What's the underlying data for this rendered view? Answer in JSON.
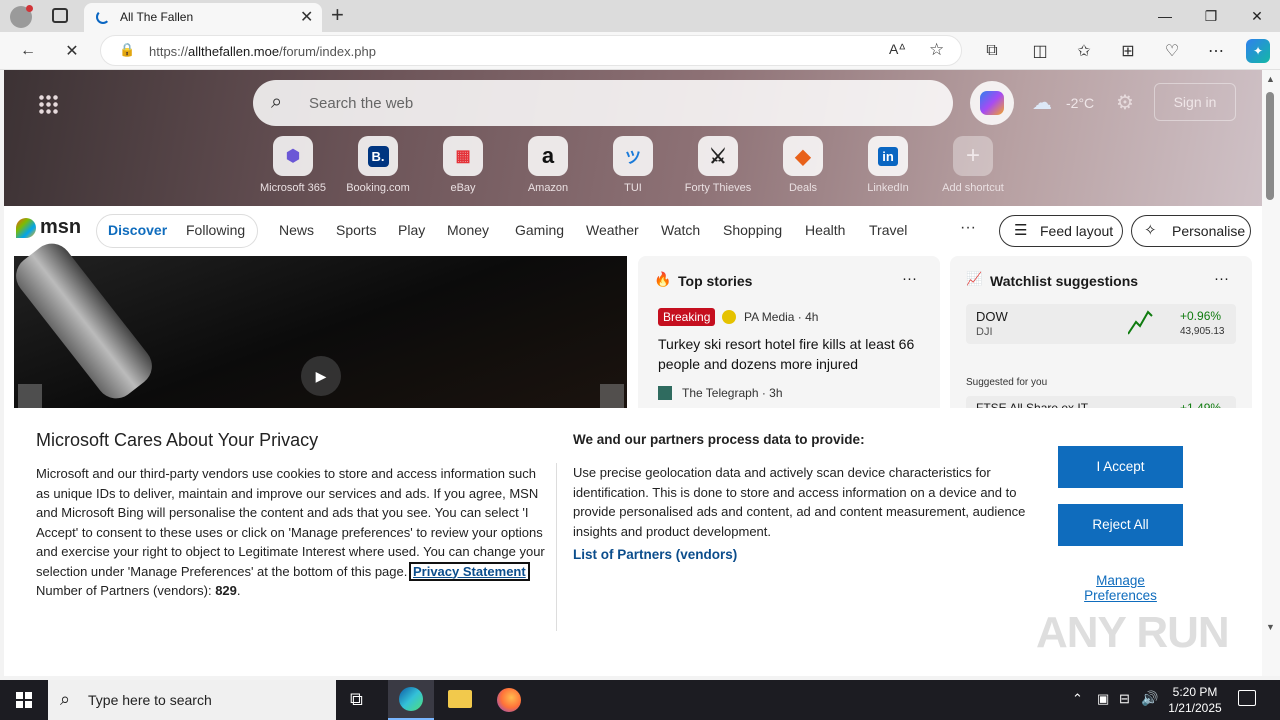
{
  "browser": {
    "tab_title": "All The Fallen",
    "url_prefix": "https://",
    "url_domain": "allthefallen.moe",
    "url_path": "/forum/index.php"
  },
  "newtab": {
    "search_placeholder": "Search the web",
    "weather": "-2°C",
    "signin": "Sign in",
    "shortcuts": [
      {
        "label": "Microsoft 365",
        "glyph": "⬢"
      },
      {
        "label": "Booking.com",
        "glyph": "B."
      },
      {
        "label": "eBay",
        "glyph": "▦"
      },
      {
        "label": "Amazon",
        "glyph": "a"
      },
      {
        "label": "TUI",
        "glyph": "ツ"
      },
      {
        "label": "Forty Thieves",
        "glyph": "⚔"
      },
      {
        "label": "Deals",
        "glyph": "◆"
      },
      {
        "label": "LinkedIn",
        "glyph": "in"
      },
      {
        "label": "Add shortcut",
        "glyph": "+"
      }
    ]
  },
  "msn": {
    "logo": "msn",
    "tabs": [
      "Discover",
      "Following"
    ],
    "nav": [
      "News",
      "Sports",
      "Play",
      "Money",
      "Gaming",
      "Weather",
      "Watch",
      "Shopping",
      "Health",
      "Travel"
    ],
    "more": "···",
    "feed_layout": "Feed layout",
    "personalise": "Personalise",
    "top_stories": {
      "title": "Top stories",
      "badge": "Breaking",
      "source1": "PA Media · 4h",
      "headline": "Turkey ski resort hotel fire kills at least 66 people and dozens more injured",
      "source2": "The Telegraph · 3h"
    },
    "watchlist": {
      "title": "Watchlist suggestions",
      "ticker": "DOW",
      "ticker_sub": "DJI",
      "change": "+0.96%",
      "value": "43,905.13",
      "suggested": "Suggested for you",
      "partial": "FTSE All Share ex IT",
      "partial_change": "+1.49%"
    }
  },
  "privacy": {
    "title": "Microsoft Cares About Your Privacy",
    "body": "Microsoft and our third-party vendors use cookies to store and access information such as unique IDs to deliver, maintain and improve our services and ads. If you agree, MSN and Microsoft Bing will personalise the content and ads that you see. You can select 'I Accept' to consent to these uses or click on 'Manage preferences' to review your options and exercise your right to object to Legitimate Interest where used.  You can change your selection under 'Manage Preferences' at the bottom of this page.",
    "privacy_link": "Privacy Statement",
    "partners_label": "Number of Partners (vendors):",
    "partners_count": "829",
    "right_title": "We and our partners process data to provide:",
    "right_body": "Use precise geolocation data and actively scan device characteristics for identification. This is done to store and access information on a device and to provide personalised ads and content, ad and content measurement, audience insights and product development.",
    "vendors_link": "List of Partners (vendors)",
    "accept": "I Accept",
    "reject": "Reject All",
    "manage": "Manage Preferences"
  },
  "taskbar": {
    "search_placeholder": "Type here to search",
    "time": "5:20 PM",
    "date": "1/21/2025"
  },
  "watermark": "ANY RUN"
}
